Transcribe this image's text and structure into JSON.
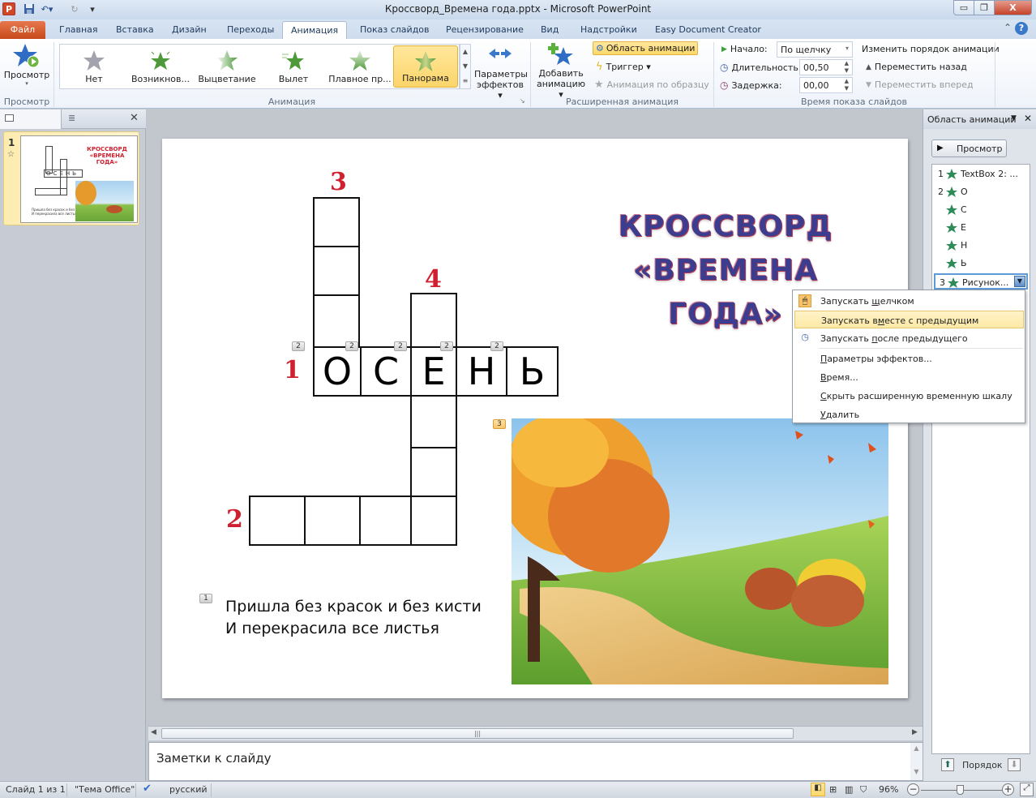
{
  "window": {
    "title": "Кроссворд_Времена года.pptx - Microsoft PowerPoint",
    "app_icon": "P",
    "controls": {
      "minimize": "▭",
      "maximize": "❐",
      "close": "X"
    }
  },
  "quick_access": {
    "save": "save-icon",
    "undo": "undo-icon",
    "redo": "redo-icon"
  },
  "tabs": [
    {
      "label": "Файл",
      "kind": "file"
    },
    {
      "label": "Главная"
    },
    {
      "label": "Вставка"
    },
    {
      "label": "Дизайн"
    },
    {
      "label": "Переходы"
    },
    {
      "label": "Анимация",
      "active": true
    },
    {
      "label": "Показ слайдов"
    },
    {
      "label": "Рецензирование"
    },
    {
      "label": "Вид"
    },
    {
      "label": "Надстройки"
    },
    {
      "label": "Easy Document Creator"
    }
  ],
  "ribbon": {
    "preview_group": {
      "button": "Просмотр",
      "label": "Просмотр"
    },
    "animation_group": {
      "label": "Анимация",
      "gallery": [
        {
          "label": "Нет",
          "color": "#a3a3ad"
        },
        {
          "label": "Возникнов...",
          "color": "#4e9a3a"
        },
        {
          "label": "Выцветание",
          "color": "#7fc46a"
        },
        {
          "label": "Вылет",
          "color": "#4e9a3a"
        },
        {
          "label": "Плавное пр...",
          "color": "#8fc27c"
        },
        {
          "label": "Панорама",
          "color": "#6ea63e",
          "selected": true
        }
      ],
      "effect_options": {
        "line1": "Параметры",
        "line2": "эффектов ▾"
      }
    },
    "advanced_group": {
      "label": "Расширенная анимация",
      "add_animation": {
        "line1": "Добавить",
        "line2": "анимацию ▾"
      },
      "animation_pane": "Область анимации",
      "trigger": "Триггер ▾",
      "animation_painter": "Анимация по образцу"
    },
    "timing_group": {
      "label": "Время показа слайдов",
      "start_label": "Начало:",
      "start_value": "По щелчку",
      "duration_label": "Длительность:",
      "duration_value": "00,50",
      "delay_label": "Задержка:",
      "delay_value": "00,00",
      "reorder_title": "Изменить порядок анимации",
      "move_earlier": "Переместить назад",
      "move_later": "Переместить вперед"
    }
  },
  "slides_panel": {
    "slide_number": "1"
  },
  "slide": {
    "title_line1": "КРОССВОРД",
    "title_line2": "«ВРЕМЕНА ГОДА»",
    "clue_numbers": {
      "n1": "1",
      "n2": "2",
      "n3": "3",
      "n4": "4"
    },
    "word1_letters": [
      "О",
      "С",
      "Е",
      "Н",
      "Ь"
    ],
    "animation_tags": {
      "word_letters": "2",
      "poem": "1",
      "picture": "3"
    },
    "poem_line1": "Пришла без красок и без кисти",
    "poem_line2": "И перекрасила все листья"
  },
  "notes": {
    "placeholder": "Заметки к слайду"
  },
  "animation_pane": {
    "title": "Область анимации",
    "play_button": "Просмотр",
    "items": [
      {
        "num": "1",
        "label": "TextBox 2: ..."
      },
      {
        "num": "2",
        "label": "О"
      },
      {
        "num": "",
        "label": "С"
      },
      {
        "num": "",
        "label": "Е"
      },
      {
        "num": "",
        "label": "Н"
      },
      {
        "num": "",
        "label": "Ь"
      },
      {
        "num": "3",
        "label": "Рисунок...",
        "selected": true
      }
    ],
    "order_label": "Порядок"
  },
  "context_menu": {
    "items": [
      {
        "pre": "Запускать ",
        "ul": "щ",
        "post": "елчком",
        "icon": "mouse-icon"
      },
      {
        "pre": "Запускать в",
        "ul": "м",
        "post": "есте с предыдущим",
        "hover": true
      },
      {
        "pre": "Запускать ",
        "ul": "п",
        "post": "осле предыдущего",
        "icon": "clock-icon"
      },
      {
        "pre": "",
        "ul": "П",
        "post": "араметры эффектов..."
      },
      {
        "pre": "",
        "ul": "В",
        "post": "ремя..."
      },
      {
        "pre": "",
        "ul": "С",
        "post": "крыть расширенную временную шкалу"
      },
      {
        "pre": "",
        "ul": "У",
        "post": "далить"
      }
    ]
  },
  "statusbar": {
    "slide_info": "Слайд 1 из 1",
    "theme": "\"Тема Office\"",
    "language": "русский",
    "zoom": "96%",
    "zoom_fraction": 0.48
  }
}
